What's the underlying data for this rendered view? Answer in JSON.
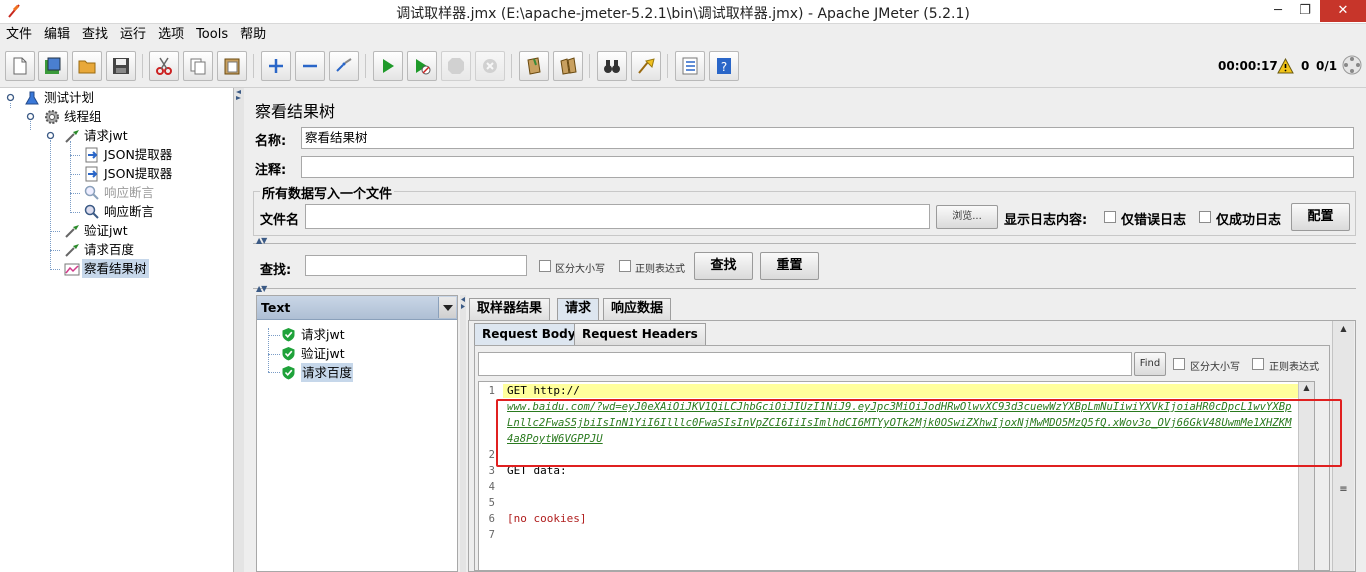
{
  "window": {
    "title": "调试取样器.jmx (E:\\apache-jmeter-5.2.1\\bin\\调试取样器.jmx) - Apache JMeter (5.2.1)",
    "minimize": "─",
    "maximize": "❐",
    "close": "✕"
  },
  "menu": [
    "文件",
    "编辑",
    "查找",
    "运行",
    "选项",
    "Tools",
    "帮助"
  ],
  "toolbar": {
    "timer": "00:00:17",
    "warnings": "0",
    "threads": "0/1"
  },
  "tree": {
    "items": [
      {
        "label": "测试计划"
      },
      {
        "label": "线程组"
      },
      {
        "label": "请求jwt"
      },
      {
        "label": "JSON提取器"
      },
      {
        "label": "JSON提取器"
      },
      {
        "label": "响应断言"
      },
      {
        "label": "响应断言"
      },
      {
        "label": "验证jwt"
      },
      {
        "label": "请求百度"
      },
      {
        "label": "察看结果树"
      }
    ]
  },
  "panel": {
    "title": "察看结果树",
    "name_label": "名称:",
    "name_value": "察看结果树",
    "comment_label": "注释:",
    "comment_value": "",
    "file_group_title": "所有数据写入一个文件",
    "filename_label": "文件名",
    "filename_value": "",
    "browse_button": "浏览...",
    "log_content_label": "显示日志内容:",
    "errors_only": "仅错误日志",
    "success_only": "仅成功日志",
    "configure_button": "配置",
    "search_label": "查找:",
    "search_value": "",
    "case_sensitive": "区分大小写",
    "regex": "正则表达式",
    "find_button": "查找",
    "reset_button": "重置"
  },
  "results": {
    "renderer": "Text",
    "items": [
      "请求jwt",
      "验证jwt",
      "请求百度"
    ]
  },
  "tabs": [
    "取样器结果",
    "请求",
    "响应数据"
  ],
  "subtabs": [
    "Request Body",
    "Request Headers"
  ],
  "inner_search": {
    "value": "",
    "find_button": "Find",
    "case_sensitive": "区分大小写",
    "regex": "正则表达式"
  },
  "code": {
    "line_numbers": [
      "1",
      "2",
      "3",
      "4",
      "5",
      "6",
      "7"
    ],
    "line1": "GET http://",
    "url": "www.baidu.com/?wd=eyJ0eXAiOiJKV1QiLCJhbGciOiJIUzI1NiJ9.eyJpc3MiOiJodHRwOlwvXC93d3cuewWzYXBpLmNuIiwiYXVkIjoiaHR0cDpcL1wvYXBpLnllc2FwaS5jbiIsInN1YiI6Illlc0FwaSIsInVpZCI6IiIsImlhdCI6MTYyOTk2Mjk0OSwiZXhwIjoxNjMwMDO5MzQ5fQ.xWov3o_OVj66GkV48UwmMe1XHZKM4a8PoytW6VGPPJU",
    "line3": "GET data:",
    "line6": "[no cookies]"
  },
  "colors": {
    "selection": "#c6d7ea",
    "link": "#2a7a1f",
    "annotation": "#e02020",
    "current_line": "#ffff9c"
  }
}
